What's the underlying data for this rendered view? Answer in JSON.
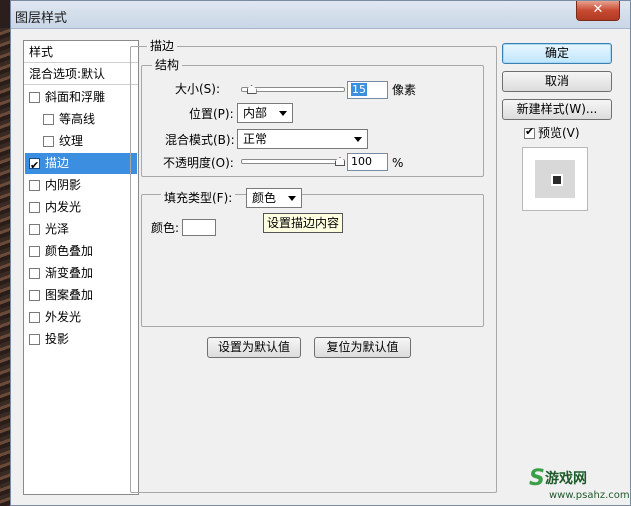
{
  "window": {
    "title": "图层样式",
    "close_glyph": "✕"
  },
  "left_panel": {
    "header": "样式",
    "blend_options": "混合选项:默认",
    "items": [
      {
        "label": "斜面和浮雕",
        "checked": false,
        "indent": false
      },
      {
        "label": "等高线",
        "checked": false,
        "indent": true
      },
      {
        "label": "纹理",
        "checked": false,
        "indent": true
      },
      {
        "label": "描边",
        "checked": true,
        "indent": false,
        "selected": true
      },
      {
        "label": "内阴影",
        "checked": false,
        "indent": false
      },
      {
        "label": "内发光",
        "checked": false,
        "indent": false
      },
      {
        "label": "光泽",
        "checked": false,
        "indent": false
      },
      {
        "label": "颜色叠加",
        "checked": false,
        "indent": false
      },
      {
        "label": "渐变叠加",
        "checked": false,
        "indent": false
      },
      {
        "label": "图案叠加",
        "checked": false,
        "indent": false
      },
      {
        "label": "外发光",
        "checked": false,
        "indent": false
      },
      {
        "label": "投影",
        "checked": false,
        "indent": false
      }
    ]
  },
  "stroke": {
    "section_title": "描边",
    "structure_title": "结构",
    "size_label": "大小(S):",
    "size_value": "15",
    "size_unit": "像素",
    "size_level": 0.06,
    "position_label": "位置(P):",
    "position_value": "内部",
    "blend_mode_label": "混合模式(B):",
    "blend_mode_value": "正常",
    "opacity_label": "不透明度(O):",
    "opacity_value": "100",
    "opacity_unit": "%",
    "opacity_level": 1.0,
    "fill_type_label": "填充类型(F):",
    "fill_type_value": "颜色",
    "tooltip": "设置描边内容",
    "color_label": "颜色:",
    "color_value": "#ffffff",
    "set_default_label": "设置为默认值",
    "reset_default_label": "复位为默认值"
  },
  "right": {
    "ok_label": "确定",
    "cancel_label": "取消",
    "new_style_label": "新建样式(W)...",
    "preview_label": "预览(V)",
    "preview_checked": true
  },
  "watermark": {
    "mark": "S",
    "text": "游戏网",
    "url": "www.psahz.com"
  },
  "colors": {
    "selection": "#3b8ee0",
    "dialog_bg": "#f0f0f0",
    "default_button": "#bee6fd"
  }
}
